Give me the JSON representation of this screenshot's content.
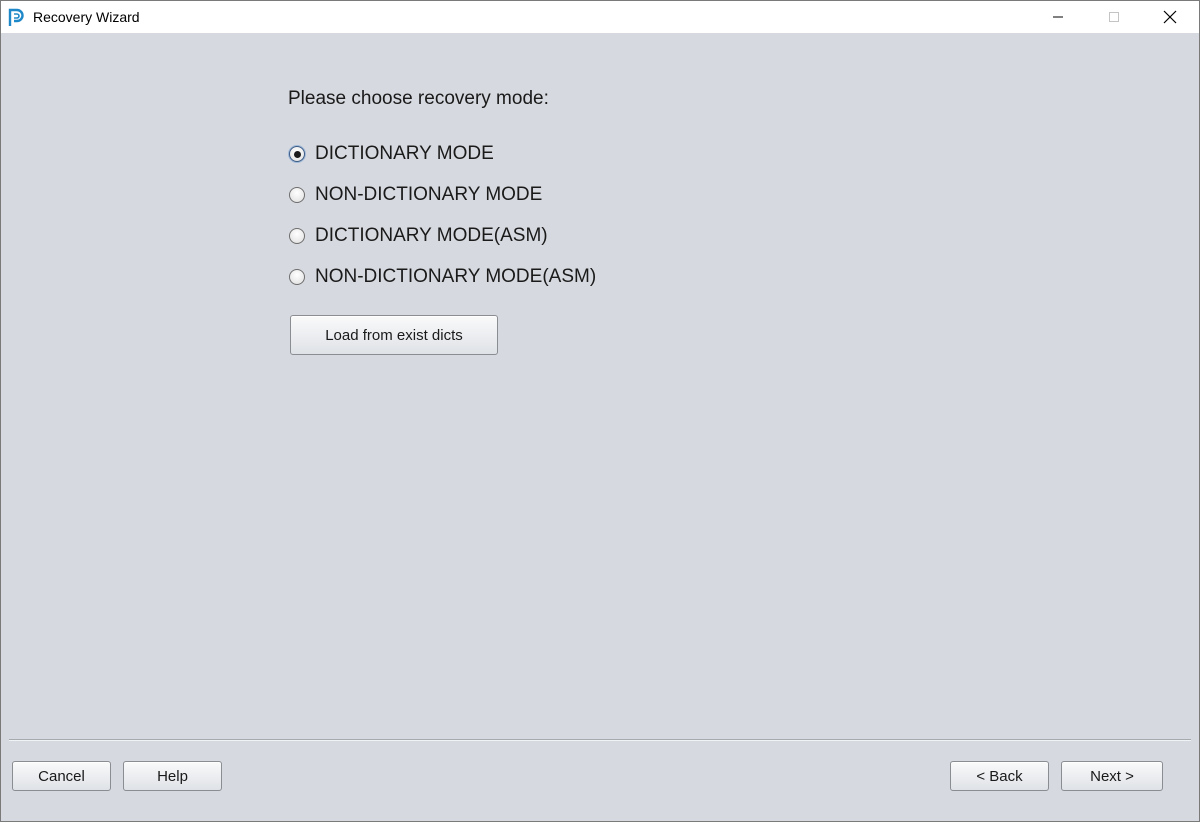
{
  "window": {
    "title": "Recovery Wizard",
    "icons": {
      "app": "p-logo-icon",
      "minimize": "minimize-icon",
      "maximize": "maximize-icon",
      "close": "close-icon"
    }
  },
  "main": {
    "prompt": "Please choose recovery mode:",
    "modes": [
      {
        "label": "DICTIONARY MODE",
        "checked": true
      },
      {
        "label": "NON-DICTIONARY MODE",
        "checked": false
      },
      {
        "label": "DICTIONARY MODE(ASM)",
        "checked": false
      },
      {
        "label": "NON-DICTIONARY MODE(ASM)",
        "checked": false
      }
    ],
    "load_button": "Load from exist dicts"
  },
  "footer": {
    "cancel": "Cancel",
    "help": "Help",
    "back": "< Back",
    "next": "Next >"
  },
  "colors": {
    "background": "#d6d9df",
    "titlebar": "#ffffff",
    "app_icon_blue": "#1e88c9"
  }
}
